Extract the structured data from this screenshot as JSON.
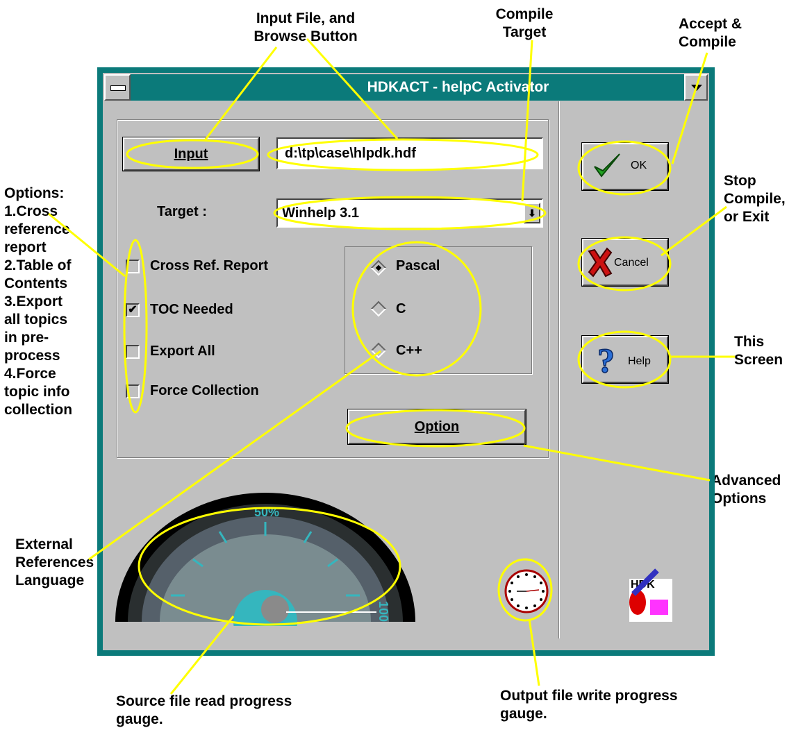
{
  "window": {
    "title": "HDKACT - helpC Activator"
  },
  "input": {
    "button_label": "Input",
    "file_value": "d:\\tp\\case\\hlpdk.hdf"
  },
  "target": {
    "label": "Target :",
    "value": "Winhelp 3.1"
  },
  "checkboxes": [
    {
      "label": "Cross Ref. Report",
      "checked": false
    },
    {
      "label": "TOC Needed",
      "checked": true
    },
    {
      "label": "Export All",
      "checked": false
    },
    {
      "label": "Force Collection",
      "checked": false
    }
  ],
  "languages": [
    {
      "label": "Pascal",
      "selected": true
    },
    {
      "label": "C",
      "selected": false
    },
    {
      "label": "C++",
      "selected": false
    }
  ],
  "option_button": "Option",
  "side_buttons": {
    "ok": "OK",
    "cancel": "Cancel",
    "help": "Help"
  },
  "gauge": {
    "label_top": "50%",
    "label_right": "100",
    "progress_percent": 0
  },
  "logo_text": "HDK",
  "annotations": {
    "input_file": [
      "Input File, and",
      "Browse Button"
    ],
    "compile_target": [
      "Compile",
      "Target"
    ],
    "accept": [
      "Accept &",
      "Compile"
    ],
    "stop": [
      "Stop",
      "Compile,",
      "or Exit"
    ],
    "help": [
      "This",
      "Screen"
    ],
    "options": [
      "Options:",
      "1.Cross",
      "reference",
      "report",
      "2.Table of",
      "Contents",
      "3.Export",
      "all topics",
      "in pre-",
      "process",
      "4.Force",
      "topic info",
      "collection"
    ],
    "advanced": [
      "Advanced",
      "Options"
    ],
    "external": [
      "External",
      "References",
      "Language"
    ],
    "source_gauge": [
      "Source file read progress",
      "gauge."
    ],
    "output_gauge": [
      "Output file write progress",
      "gauge."
    ]
  },
  "colors": {
    "window_frame": "#0b7a7a",
    "face": "#c0c0c0",
    "highlight_ellipse": "#ffff00",
    "check_icon": "#22a322",
    "cancel_icon": "#cc1111",
    "help_icon": "#2b6fd6"
  }
}
